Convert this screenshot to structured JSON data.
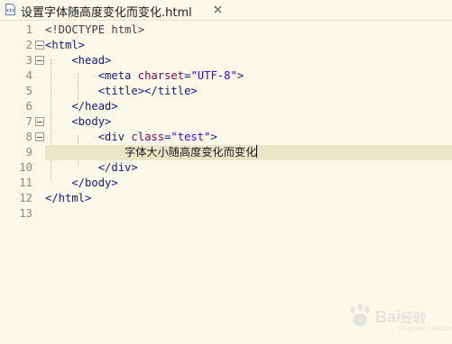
{
  "tab": {
    "title": "设置字体随高度变化而变化.html",
    "file_icon": "html-file-icon",
    "close_icon": "close-icon"
  },
  "editor": {
    "lines": [
      {
        "num": "1",
        "fold": false,
        "parts": [
          {
            "t": "<!DOCTYPE html>",
            "c": "doctype"
          }
        ]
      },
      {
        "num": "2",
        "fold": true,
        "parts": [
          {
            "t": "<html>",
            "c": "tag"
          }
        ]
      },
      {
        "num": "3",
        "fold": true,
        "parts": [
          {
            "t": "    <head>",
            "c": "tag"
          }
        ]
      },
      {
        "num": "4",
        "fold": false,
        "parts": [
          {
            "t": "        <meta ",
            "c": "tag"
          },
          {
            "t": "charset",
            "c": "attr"
          },
          {
            "t": "=",
            "c": "tag"
          },
          {
            "t": "\"UTF-8\"",
            "c": "val"
          },
          {
            "t": ">",
            "c": "tag"
          }
        ]
      },
      {
        "num": "5",
        "fold": false,
        "parts": [
          {
            "t": "        <title></title>",
            "c": "tag"
          }
        ]
      },
      {
        "num": "6",
        "fold": false,
        "parts": [
          {
            "t": "    </head>",
            "c": "tag"
          }
        ]
      },
      {
        "num": "7",
        "fold": true,
        "parts": [
          {
            "t": "    <body>",
            "c": "tag"
          }
        ]
      },
      {
        "num": "8",
        "fold": true,
        "parts": [
          {
            "t": "        <div ",
            "c": "tag"
          },
          {
            "t": "class",
            "c": "attr"
          },
          {
            "t": "=",
            "c": "tag"
          },
          {
            "t": "\"test\"",
            "c": "val"
          },
          {
            "t": ">",
            "c": "tag"
          }
        ]
      },
      {
        "num": "9",
        "fold": false,
        "current": true,
        "parts": [
          {
            "t": "            ",
            "c": "tag"
          },
          {
            "t": "字体大小随高度变化而变化",
            "c": "text"
          }
        ]
      },
      {
        "num": "10",
        "fold": false,
        "parts": [
          {
            "t": "        </div>",
            "c": "tag"
          }
        ]
      },
      {
        "num": "11",
        "fold": false,
        "parts": [
          {
            "t": "    </body>",
            "c": "tag"
          }
        ]
      },
      {
        "num": "12",
        "fold": false,
        "parts": [
          {
            "t": "</html>",
            "c": "tag"
          }
        ]
      },
      {
        "num": "13",
        "fold": false,
        "parts": []
      }
    ]
  },
  "watermark": {
    "logo_text": "Bai",
    "logo_suffix": "经验",
    "sub_text": "jingyan.baidu.com",
    "icon": "baidu-paw-icon"
  },
  "colors": {
    "background": "#fbf9ea",
    "current_line": "#ebe5c8",
    "tag": "#17177e",
    "attribute": "#7f0055",
    "value": "#2a00ff"
  }
}
